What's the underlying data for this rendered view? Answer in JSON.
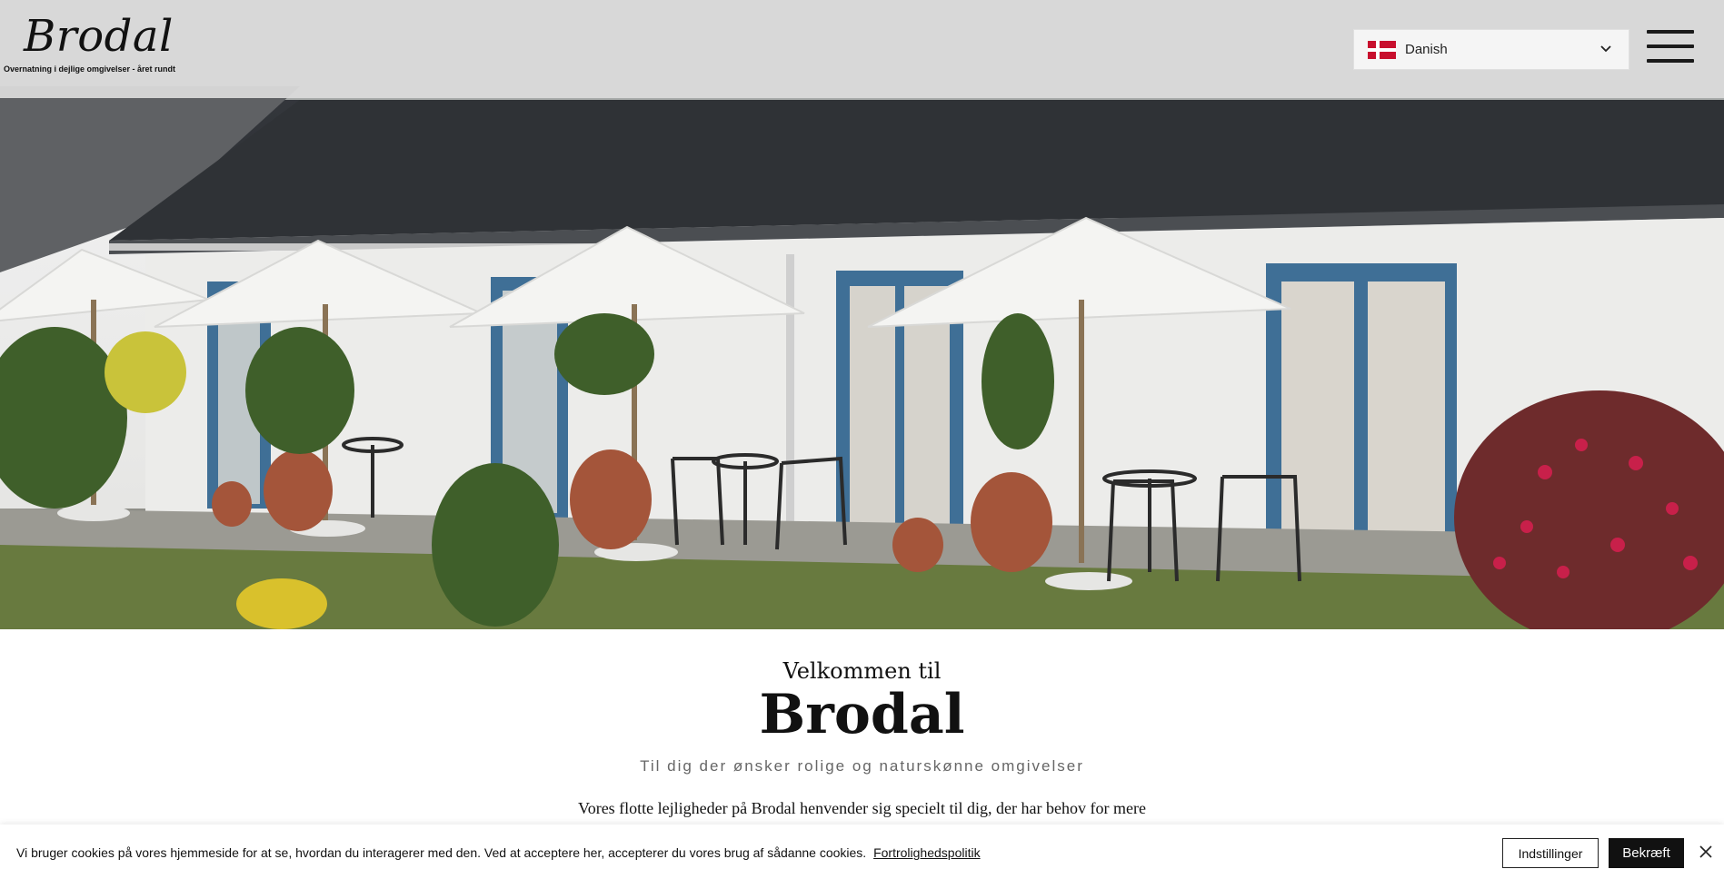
{
  "header": {
    "logo": "Brodal",
    "tagline": "Overnatning i dejlige omgivelser - året rundt",
    "language": {
      "selected": "Danish",
      "flag_icon": "denmark-flag-icon"
    },
    "menu_icon": "hamburger-menu-icon"
  },
  "hero": {
    "image": "photo of white guesthouse with blue-framed doors, white patio umbrellas, bistro tables and chairs, potted trees and flowers"
  },
  "main": {
    "welcome": "Velkommen til",
    "title": "Brodal",
    "subtitle": "Til dig der ønsker rolige og naturskønne omgivelser",
    "intro": "Vores flotte lejligheder på Brodal henvender sig specielt til dig, der har behov for mere"
  },
  "cookie_bar": {
    "text": "Vi bruger cookies på vores hjemmeside for at se, hvordan du interagerer med den. Ved at acceptere her, accepterer du vores brug af sådanne cookies.",
    "policy_link": "Fortrolighedspolitik",
    "settings_button": "Indstillinger",
    "confirm_button": "Bekræft",
    "close_icon": "close-icon"
  },
  "colors": {
    "header_bg": "#dcdcdc",
    "text": "#111111",
    "subtitle": "#666666",
    "confirm_bg": "#111111",
    "door_blue": "#3f6f96"
  }
}
